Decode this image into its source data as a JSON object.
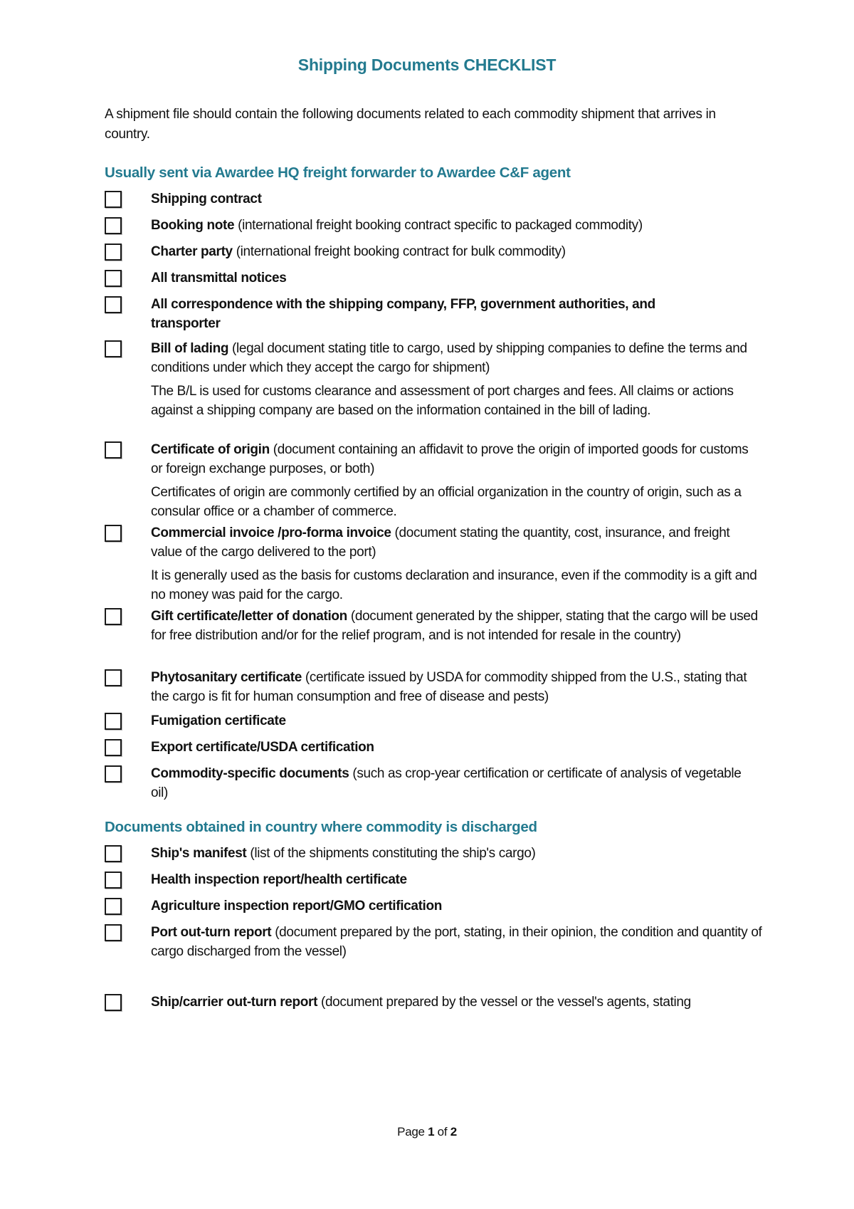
{
  "document": {
    "title": "Shipping Documents CHECKLIST",
    "intro": "A shipment file should contain the following documents related to each commodity shipment that arrives in country."
  },
  "accent_color": "#237a8f",
  "sections": [
    {
      "heading": "Usually sent via Awardee HQ freight forwarder to Awardee C&F agent",
      "items": [
        {
          "label": "Shipping contract",
          "description": "",
          "note": "",
          "checked": false
        },
        {
          "label": "Booking note",
          "description": " (international freight booking contract specific to packaged commodity)",
          "note": "",
          "checked": false
        },
        {
          "label": "Charter party",
          "description": " (international freight booking contract for bulk commodity)",
          "note": "",
          "checked": false
        },
        {
          "label": "All transmittal notices",
          "description": "",
          "note": "",
          "checked": false
        },
        {
          "label": "All correspondence with the shipping company, FFP, government authorities, and transporter",
          "description": "",
          "note": "",
          "checked": false
        },
        {
          "label": "Bill of lading",
          "description": " (legal document stating title to cargo, used by shipping companies to define the terms and conditions under which they accept the cargo for shipment)",
          "note": "The B/L is used for customs clearance and assessment of port charges and fees. All claims or actions against a shipping company are based on the information contained in the bill of lading.",
          "checked": false
        },
        {
          "label": "Certificate of origin",
          "description": " (document containing an affidavit to prove the origin of imported goods for customs or foreign exchange purposes, or both)",
          "note": "Certificates of origin are commonly certified by an official organization in the country of origin, such as a consular office or a chamber of commerce.",
          "checked": false
        },
        {
          "label": "Commercial invoice /pro-forma invoice",
          "description": " (document stating the quantity, cost, insurance, and freight value of the cargo delivered to the port)",
          "note": "It is generally used as the basis for customs declaration and insurance, even if the commodity is a gift and no money was paid for the cargo.",
          "checked": false
        },
        {
          "label": "Gift certificate/letter of donation",
          "description": " (document generated by the shipper, stating that the cargo will be used for free distribution and/or for the relief program, and is not intended for resale in the country)",
          "note": "",
          "checked": false
        },
        {
          "label": "Phytosanitary certificate",
          "description": " (certificate issued by USDA for commodity shipped from the U.S., stating that the cargo is fit for human consumption and free of disease and pests)",
          "note": "",
          "checked": false
        },
        {
          "label": "Fumigation certificate",
          "description": "",
          "note": "",
          "checked": false
        },
        {
          "label": "Export certificate/USDA certification",
          "description": "",
          "note": "",
          "checked": false
        },
        {
          "label": "Commodity-specific documents",
          "description": " (such as crop-year certification or certificate of analysis of vegetable oil)",
          "note": "",
          "checked": false
        }
      ]
    },
    {
      "heading": "Documents obtained in country where commodity is discharged",
      "items": [
        {
          "label": "Ship's manifest",
          "description": " (list of the shipments constituting the ship's cargo)",
          "note": "",
          "checked": false
        },
        {
          "label": "Health inspection report/health certificate",
          "description": "",
          "note": "",
          "checked": false
        },
        {
          "label": "Agriculture inspection report/GMO certification",
          "description": "",
          "note": "",
          "checked": false
        },
        {
          "label": "Port out-turn report",
          "description": " (document prepared by the port, stating, in their opinion, the condition and quantity of cargo discharged from the vessel)",
          "note": "",
          "checked": false
        },
        {
          "label": "Ship/carrier out-turn report",
          "description": " (document prepared by the vessel or the vessel's agents, stating",
          "note": "",
          "checked": false
        }
      ]
    }
  ],
  "footer": {
    "page_word": "Page ",
    "current_page": "1",
    "of_word": " of ",
    "total_pages": "2"
  }
}
